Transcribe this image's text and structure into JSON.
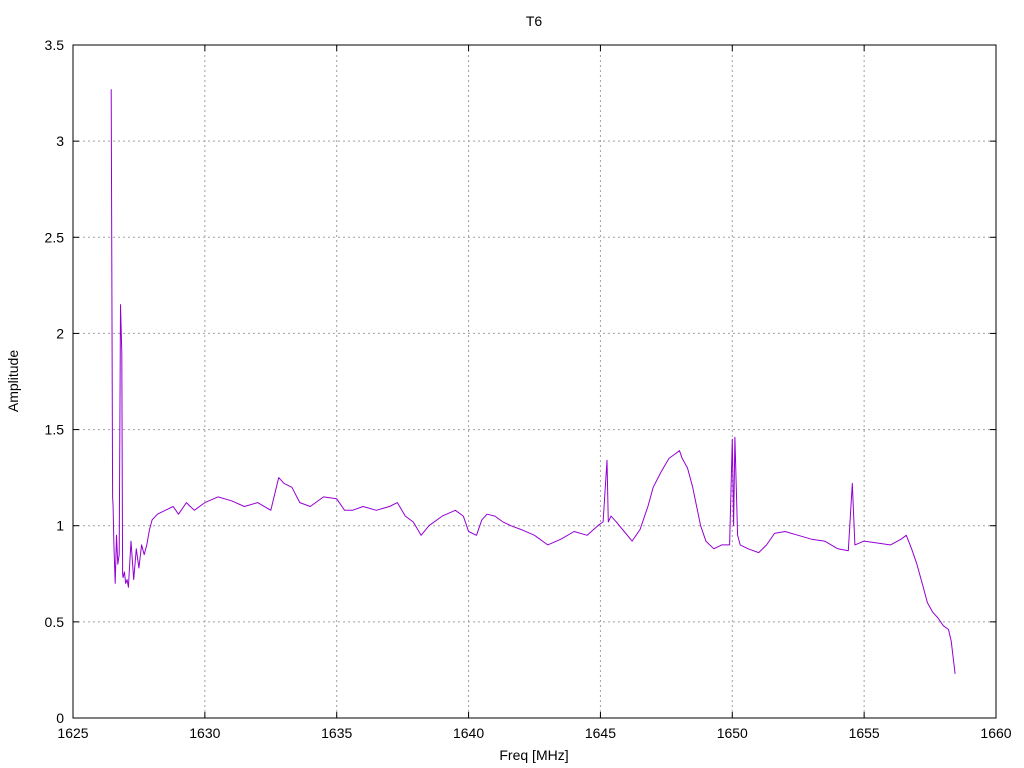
{
  "chart_data": {
    "type": "line",
    "title": "T6",
    "xlabel": "Freq [MHz]",
    "ylabel": "Amplitude",
    "xlim": [
      1625,
      1660
    ],
    "ylim": [
      0,
      3.5
    ],
    "xticks": [
      "1625",
      "1630",
      "1635",
      "1640",
      "1645",
      "1650",
      "1655",
      "1660"
    ],
    "yticks": [
      "0",
      "0.5",
      "1",
      "1.5",
      "2",
      "2.5",
      "3",
      "3.5"
    ],
    "grid": true,
    "series": [
      {
        "color": "#9400d3",
        "x": [
          1626.45,
          1626.5,
          1626.52,
          1626.55,
          1626.6,
          1626.65,
          1626.7,
          1626.75,
          1626.8,
          1626.85,
          1626.88,
          1626.9,
          1626.95,
          1627.0,
          1627.05,
          1627.1,
          1627.2,
          1627.3,
          1627.4,
          1627.5,
          1627.6,
          1627.7,
          1627.8,
          1627.9,
          1628.0,
          1628.2,
          1628.5,
          1628.8,
          1629.0,
          1629.3,
          1629.6,
          1630.0,
          1630.5,
          1631.0,
          1631.5,
          1632.0,
          1632.5,
          1632.8,
          1633.0,
          1633.3,
          1633.6,
          1634.0,
          1634.5,
          1635.0,
          1635.3,
          1635.6,
          1636.0,
          1636.5,
          1637.0,
          1637.3,
          1637.6,
          1637.9,
          1638.2,
          1638.5,
          1639.0,
          1639.5,
          1639.8,
          1640.0,
          1640.3,
          1640.5,
          1640.7,
          1641.0,
          1641.3,
          1641.6,
          1642.0,
          1642.5,
          1643.0,
          1643.5,
          1644.0,
          1644.5,
          1644.9,
          1645.1,
          1645.25,
          1645.3,
          1645.4,
          1645.6,
          1645.9,
          1646.2,
          1646.5,
          1646.8,
          1647.0,
          1647.3,
          1647.6,
          1647.9,
          1648.0,
          1648.1,
          1648.3,
          1648.5,
          1648.8,
          1649.0,
          1649.3,
          1649.6,
          1649.9,
          1650.0,
          1650.05,
          1650.1,
          1650.2,
          1650.3,
          1650.6,
          1651.0,
          1651.3,
          1651.6,
          1652.0,
          1652.5,
          1653.0,
          1653.5,
          1654.0,
          1654.4,
          1654.55,
          1654.65,
          1655.0,
          1655.5,
          1656.0,
          1656.4,
          1656.6,
          1656.8,
          1657.0,
          1657.2,
          1657.4,
          1657.6,
          1657.8,
          1658.0,
          1658.2,
          1658.3,
          1658.45
        ],
        "y": [
          3.27,
          1.15,
          1.1,
          0.9,
          0.7,
          0.95,
          0.8,
          0.85,
          2.15,
          1.9,
          0.75,
          0.73,
          0.76,
          0.7,
          0.72,
          0.68,
          0.92,
          0.72,
          0.88,
          0.78,
          0.9,
          0.85,
          0.9,
          0.98,
          1.03,
          1.06,
          1.08,
          1.1,
          1.06,
          1.12,
          1.08,
          1.12,
          1.15,
          1.13,
          1.1,
          1.12,
          1.08,
          1.25,
          1.22,
          1.2,
          1.12,
          1.1,
          1.15,
          1.14,
          1.08,
          1.08,
          1.1,
          1.08,
          1.1,
          1.12,
          1.05,
          1.02,
          0.95,
          1.0,
          1.05,
          1.08,
          1.05,
          0.97,
          0.95,
          1.03,
          1.06,
          1.05,
          1.02,
          1.0,
          0.98,
          0.95,
          0.9,
          0.93,
          0.97,
          0.95,
          1.0,
          1.02,
          1.34,
          1.02,
          1.05,
          1.02,
          0.97,
          0.92,
          0.98,
          1.1,
          1.2,
          1.28,
          1.35,
          1.38,
          1.39,
          1.35,
          1.3,
          1.2,
          1.0,
          0.92,
          0.88,
          0.9,
          0.9,
          1.45,
          1.0,
          1.46,
          0.95,
          0.9,
          0.88,
          0.86,
          0.9,
          0.96,
          0.97,
          0.95,
          0.93,
          0.92,
          0.88,
          0.87,
          1.22,
          0.9,
          0.92,
          0.91,
          0.9,
          0.93,
          0.95,
          0.88,
          0.8,
          0.7,
          0.6,
          0.55,
          0.52,
          0.48,
          0.46,
          0.4,
          0.23
        ]
      }
    ]
  }
}
